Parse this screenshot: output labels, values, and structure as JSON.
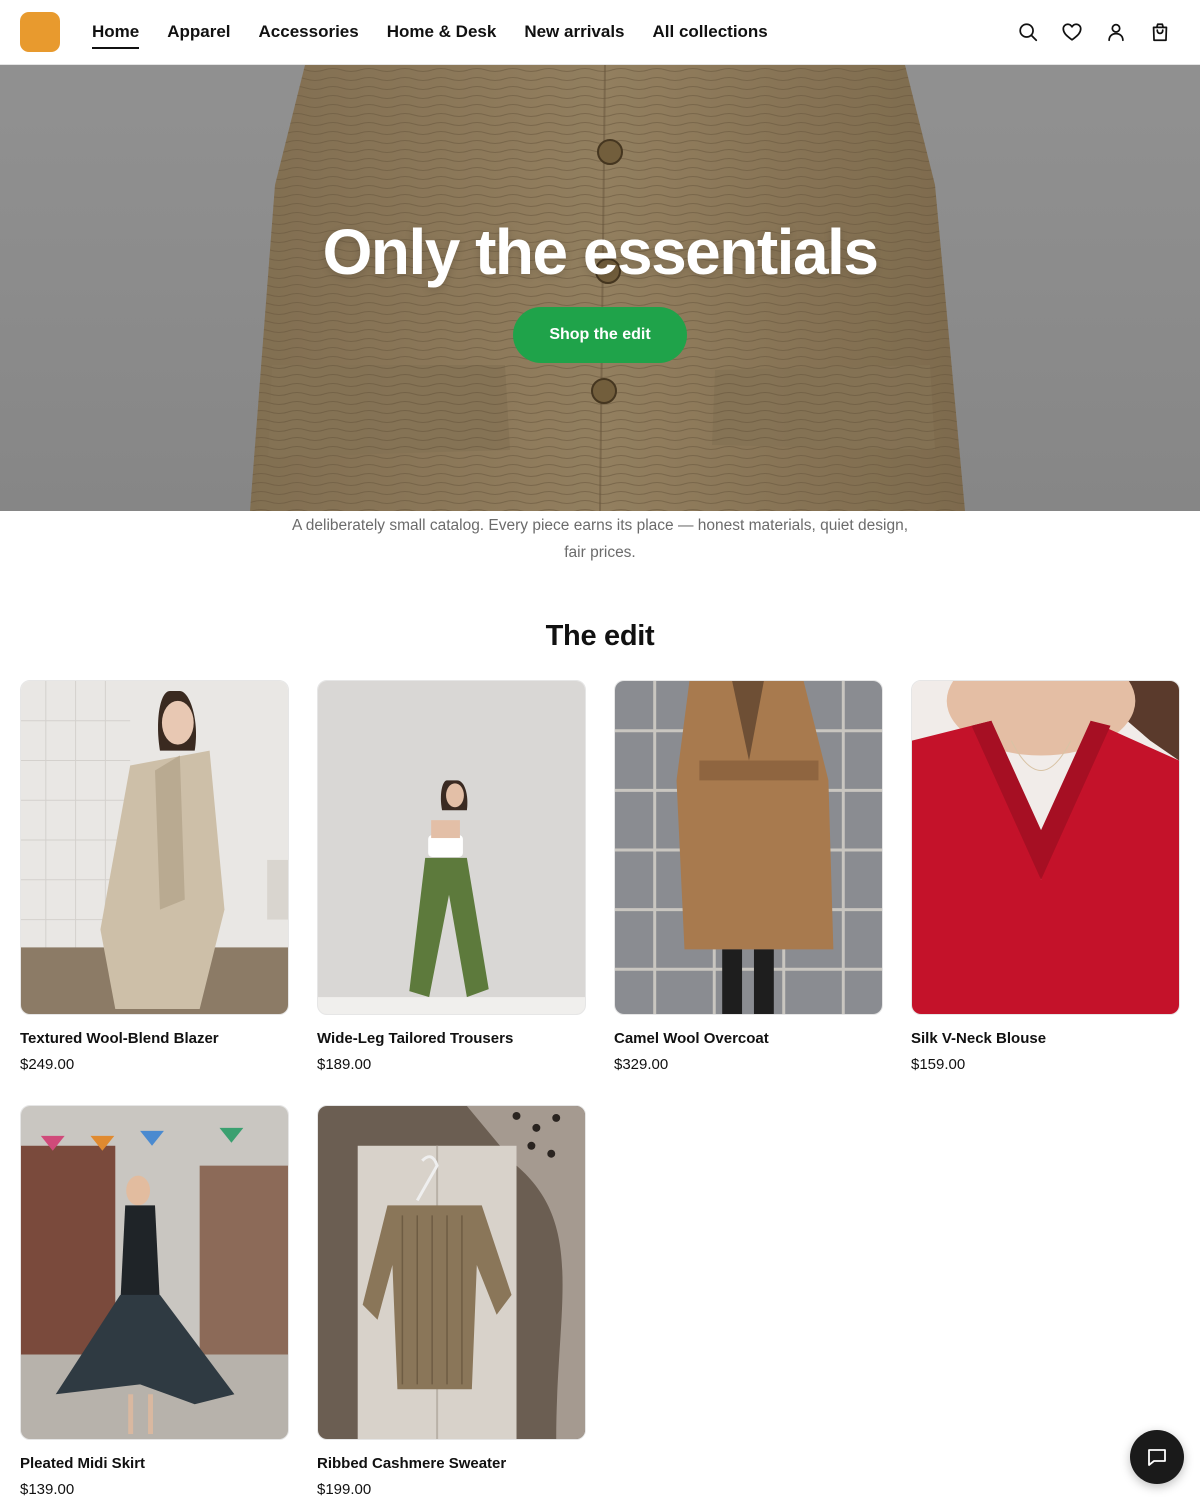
{
  "brand": {
    "logo_color": "#e89a2e"
  },
  "nav": {
    "items": [
      {
        "label": "Home",
        "active": true
      },
      {
        "label": "Apparel"
      },
      {
        "label": "Accessories"
      },
      {
        "label": "Home & Desk"
      },
      {
        "label": "New arrivals"
      },
      {
        "label": "All collections"
      }
    ]
  },
  "header_icons": [
    "search-icon",
    "heart-icon",
    "user-icon",
    "bag-icon"
  ],
  "hero": {
    "title": "Only the essentials",
    "cta_label": "Shop the edit",
    "cta_color": "#1fa34a"
  },
  "tagline": "A deliberately small catalog. Every piece earns its place — honest materials, quiet design, fair prices.",
  "section_title": "The edit",
  "products": [
    {
      "name": "Textured Wool-Blend Blazer",
      "price": "$249.00"
    },
    {
      "name": "Wide-Leg Tailored Trousers",
      "price": "$189.00"
    },
    {
      "name": "Camel Wool Overcoat",
      "price": "$329.00"
    },
    {
      "name": "Silk V-Neck Blouse",
      "price": "$159.00"
    },
    {
      "name": "Pleated Midi Skirt",
      "price": "$139.00"
    },
    {
      "name": "Ribbed Cashmere Sweater",
      "price": "$199.00"
    }
  ],
  "chat_icon": "chat-icon"
}
